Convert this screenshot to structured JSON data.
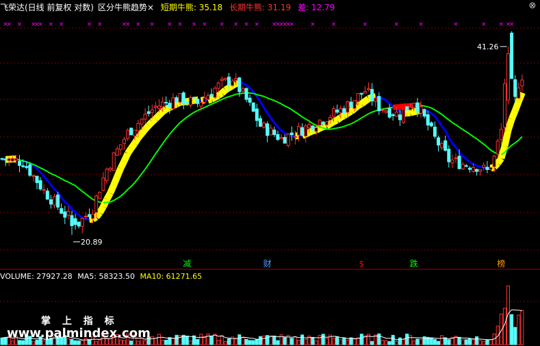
{
  "header": {
    "stock": "飞荣达(日线 前复权 对数)",
    "indicator": "区分牛熊趋势",
    "short_label": "短期牛熊: 35.18",
    "long_label": "长期牛熊: 31.19",
    "diff_label": "差: 12.79"
  },
  "volume_header": {
    "volume": "VOLUME: 27927.28",
    "ma5": "MA5: 58323.50",
    "ma10": "MA10: 61271.65"
  },
  "colors": {
    "up": "#ff3232",
    "down": "#54ffff",
    "short_bull": "#ffff00",
    "long_bear": "#ff0000",
    "blue_line": "#0000ff",
    "green_line": "#00ff00",
    "grid": "#800000",
    "marker": "#ff00ff"
  },
  "watermark": {
    "line1": "掌 上 指 标",
    "line2": "www.palmindex.com"
  },
  "chart_data": {
    "type": "candlestick",
    "price_range": [
      18.5,
      46.0
    ],
    "log_scale": true,
    "annotations": {
      "high": "41.26",
      "low": "20.89"
    },
    "signals": [
      {
        "label": "减",
        "index": 53,
        "color": "#00ff00"
      },
      {
        "label": "财",
        "index": 76,
        "color": "#4aa0ff"
      },
      {
        "label": "$",
        "index": 103,
        "color": "#ff0000"
      },
      {
        "label": "跌",
        "index": 118,
        "color": "#00ff00"
      },
      {
        "label": "榜",
        "index": 143,
        "color": "#ffa000"
      }
    ],
    "marker_indices": [
      1,
      2,
      5,
      9,
      10,
      11,
      14,
      17,
      25,
      28,
      35,
      36,
      39,
      43,
      48,
      51,
      55,
      58,
      63,
      67,
      70,
      73,
      78,
      79,
      80,
      81,
      82,
      83,
      89,
      95,
      104,
      113,
      120,
      130,
      138,
      143,
      145,
      146
    ],
    "ohlc": [],
    "volume": [],
    "vol_ma": []
  }
}
